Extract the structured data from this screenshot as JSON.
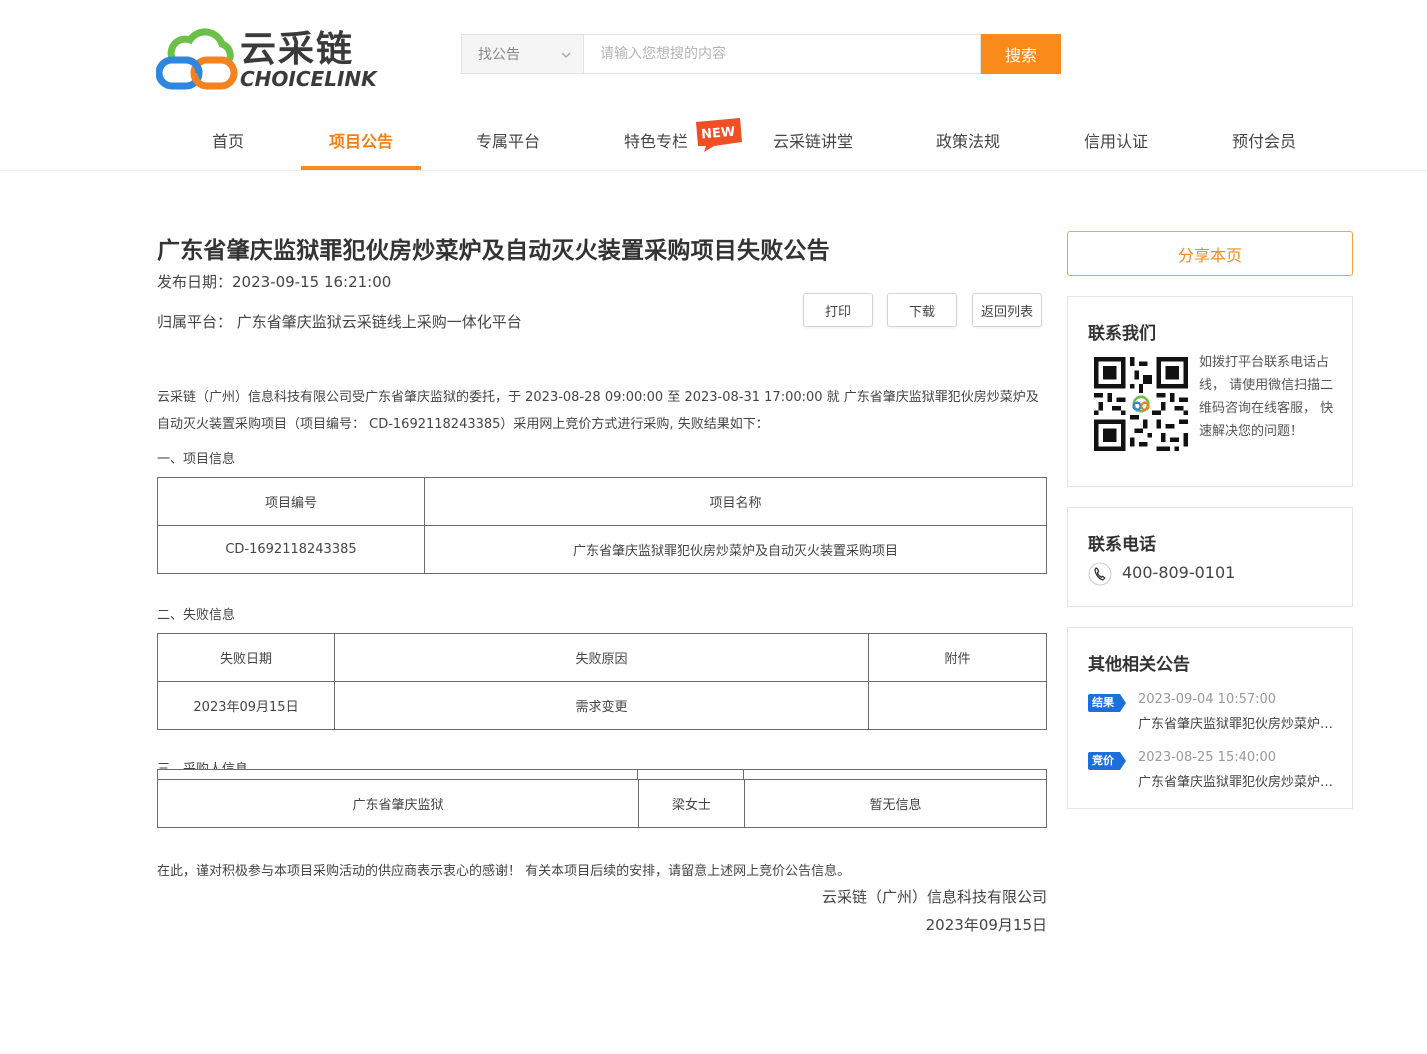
{
  "header": {
    "logo_cn": "云采链",
    "logo_en": "CHOICELINK",
    "search": {
      "select_value": "找公告",
      "placeholder": "请输入您想搜的内容",
      "button": "搜索"
    },
    "nav": [
      {
        "label": "首页"
      },
      {
        "label": "项目公告"
      },
      {
        "label": "专属平台"
      },
      {
        "label": "特色专栏"
      },
      {
        "label": "云采链讲堂"
      },
      {
        "label": "政策法规"
      },
      {
        "label": "信用认证"
      },
      {
        "label": "预付会员"
      }
    ],
    "new_badge": "NEW",
    "active_color": "#f88b1a"
  },
  "article": {
    "title": "广东省肇庆监狱罪犯伙房炒菜炉及自动灭火装置采购项目失败公告",
    "publish_date": "发布日期：2023-09-15 16:21:00",
    "platform": "归属平台：  广东省肇庆监狱云采链线上采购一体化平台",
    "buttons": {
      "print": "打印",
      "download": "下载",
      "back": "返回列表"
    },
    "intro": "云采链（广州）信息科技有限公司受广东省肇庆监狱的委托，于 2023-08-28 09:00:00 至 2023-08-31 17:00:00 就 广东省肇庆监狱罪犯伙房炒菜炉及自动灭火装置采购项目（项目编号：  CD-1692118243385）采用网上竞价方式进行采购, 失败结果如下：",
    "section1": {
      "heading": "一、项目信息",
      "headers": [
        "项目编号",
        "项目名称"
      ],
      "row": [
        "CD-1692118243385",
        "广东省肇庆监狱罪犯伙房炒菜炉及自动灭火装置采购项目"
      ]
    },
    "section2": {
      "heading": "二、失败信息",
      "headers": [
        "失败日期",
        "失败原因",
        "附件"
      ],
      "row": [
        "2023年09月15日",
        "需求变更",
        ""
      ]
    },
    "section3": {
      "heading": "三、采购人信息",
      "row": [
        "广东省肇庆监狱",
        "梁女士",
        "暂无信息"
      ]
    },
    "closing": "在此，谨对积极参与本项目采购活动的供应商表示衷心的感谢！ 有关本项目后续的安排，请留意上述网上竞价公告信息。",
    "signature_company": "云采链（广州）信息科技有限公司",
    "signature_date": "2023年09月15日"
  },
  "sidebar": {
    "share": "分享本页",
    "contact": {
      "title": "联系我们",
      "text": "如拨打平台联系电话占线， 请使用微信扫描二维码咨询在线客服， 快速解决您的问题！"
    },
    "phone": {
      "title": "联系电话",
      "number": "400-809-0101"
    },
    "related": {
      "title": "其他相关公告",
      "items": [
        {
          "tag": "结果",
          "tag_color": "#1e6fd9",
          "date": "2023-09-04 10:57:00",
          "title": "广东省肇庆监狱罪犯伙房炒菜炉及自动灭火装置采购项目结果公告"
        },
        {
          "tag": "竞价",
          "tag_color": "#1e6fd9",
          "date": "2023-08-25 15:40:00",
          "title": "广东省肇庆监狱罪犯伙房炒菜炉及自动灭火装置采购项目竞价公告"
        }
      ]
    }
  }
}
